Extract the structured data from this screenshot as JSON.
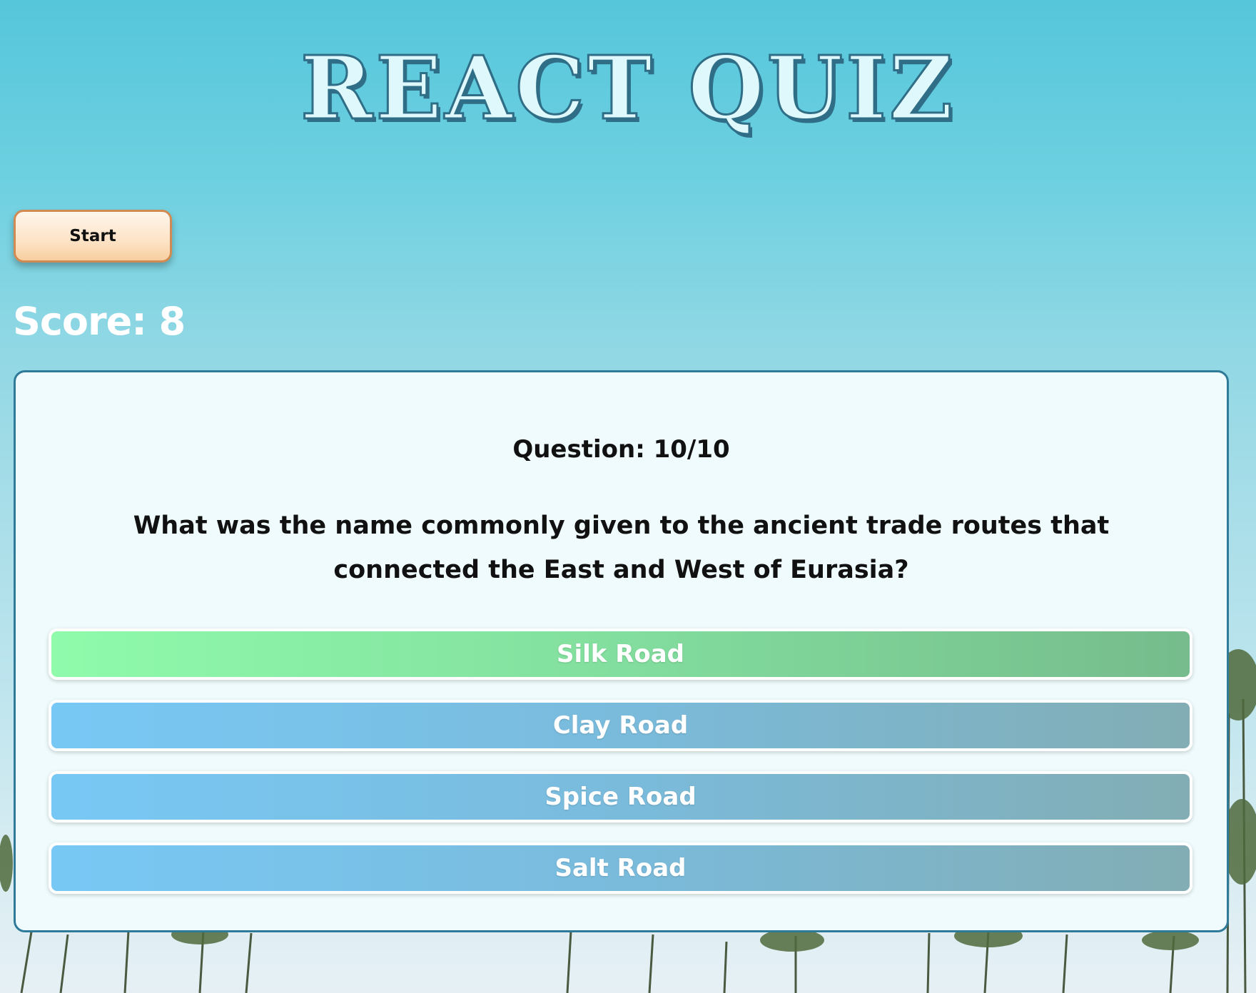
{
  "title": "REACT QUIZ",
  "start_button": {
    "label": "Start"
  },
  "score": {
    "text": "Score: 8"
  },
  "question": {
    "counter": "Question: 10/10",
    "text": "What was the name commonly given to the ancient trade routes that connected the East and West of Eurasia?"
  },
  "answers": [
    {
      "label": "Silk Road",
      "state": "correct"
    },
    {
      "label": "Clay Road",
      "state": "default"
    },
    {
      "label": "Spice Road",
      "state": "default"
    },
    {
      "label": "Salt Road",
      "state": "default"
    }
  ],
  "colors": {
    "sky_top": "#56c6db",
    "card_border": "#2f7a98",
    "correct_answer": "#82de9e",
    "default_answer": "#7abbdc",
    "start_button": "#fde3c6"
  }
}
